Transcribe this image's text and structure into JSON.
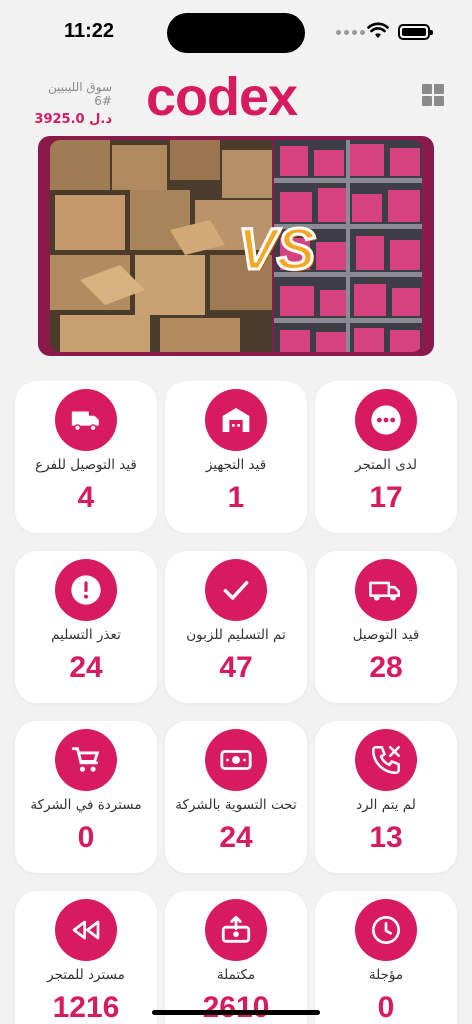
{
  "status_bar": {
    "time": "11:22"
  },
  "header": {
    "store_name": "سوق الليبيين #6",
    "balance": "3925.0 د.ل",
    "logo": "codex"
  },
  "banner": {
    "vs_text": "VS"
  },
  "colors": {
    "accent": "#d81b60",
    "card_bg": "#ffffff",
    "page_bg": "#f2f2f2"
  },
  "cards": [
    {
      "label": "قيد التوصيل للفرع",
      "count": "4",
      "icon": "truck-icon"
    },
    {
      "label": "قيد التجهيز",
      "count": "1",
      "icon": "warehouse-icon"
    },
    {
      "label": "لدى المتجر",
      "count": "17",
      "icon": "more-dots-icon"
    },
    {
      "label": "تعذر التسليم",
      "count": "24",
      "icon": "alert-icon"
    },
    {
      "label": "تم التسليم للزبون",
      "count": "47",
      "icon": "check-icon"
    },
    {
      "label": "قيد التوصيل",
      "count": "28",
      "icon": "delivery-truck-icon"
    },
    {
      "label": "مستردة في الشركة",
      "count": "0",
      "icon": "cart-icon"
    },
    {
      "label": "تحت التسوية بالشركة",
      "count": "24",
      "icon": "money-icon"
    },
    {
      "label": "لم يتم الرد",
      "count": "13",
      "icon": "phone-missed-icon"
    },
    {
      "label": "مسترد للمتجر",
      "count": "1216",
      "icon": "rewind-icon"
    },
    {
      "label": "مكتملة",
      "count": "2610",
      "icon": "box-upload-icon"
    },
    {
      "label": "مؤجلة",
      "count": "0",
      "icon": "clock-icon"
    }
  ]
}
